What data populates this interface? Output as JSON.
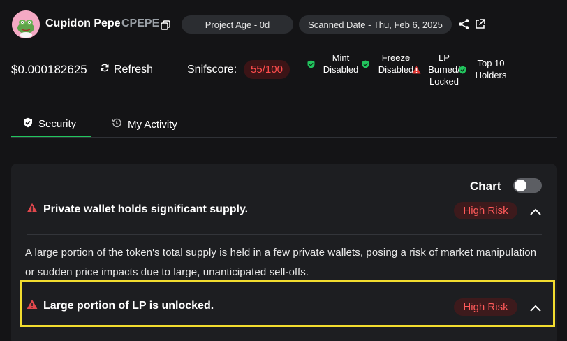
{
  "header": {
    "token_name": "Cupidon Pepe",
    "token_symbol": "CPEPE",
    "project_age": "Project Age - 0d",
    "scanned_date": "Scanned Date - Thu, Feb 6, 2025"
  },
  "stats": {
    "price": "$0.000182625",
    "refresh_label": "Refresh",
    "snifscore_label": "Snifscore:",
    "snifscore_value": "55/100",
    "flags": [
      {
        "line1": "Mint",
        "line2": "Disabled",
        "status": "ok"
      },
      {
        "line1": "Freeze",
        "line2": "Disabled",
        "status": "ok"
      },
      {
        "line1": "LP",
        "line2": "Burned/",
        "line3": "Locked",
        "status": "warning"
      },
      {
        "line1": "Top 10",
        "line2": "Holders",
        "status": "ok"
      }
    ]
  },
  "tabs": [
    {
      "label": "Security",
      "icon": "shield-icon",
      "active": true
    },
    {
      "label": "My Activity",
      "icon": "history-icon",
      "active": false
    }
  ],
  "card": {
    "chart_label": "Chart",
    "chart_toggle_on": false,
    "risks": [
      {
        "title": "Private wallet holds significant supply.",
        "badge": "High Risk",
        "expanded": true,
        "description": "A large portion of the token's total supply is held in a few private wallets, posing a risk of market manipulation or sudden price impacts due to large, unanticipated sell-offs."
      },
      {
        "title": "Large portion of LP is unlocked.",
        "badge": "High Risk",
        "expanded": true
      }
    ]
  },
  "colors": {
    "background": "#141416",
    "card": "#1d1e21",
    "accent_green": "#22c55e",
    "risk_red": "#ff5a5a",
    "highlight_yellow": "#f2dc2f"
  }
}
